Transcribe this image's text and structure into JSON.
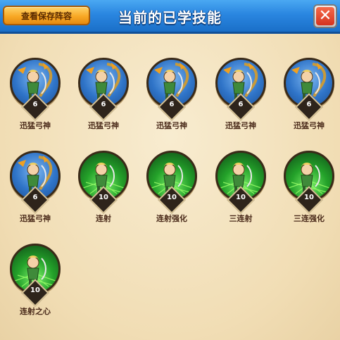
{
  "header": {
    "title": "当前的已学技能",
    "view_button_label": "查看保存阵容",
    "close_label": "✕"
  },
  "skills": [
    {
      "name": "迅猛弓神",
      "level": "6",
      "style": "blue"
    },
    {
      "name": "迅猛弓神",
      "level": "6",
      "style": "blue"
    },
    {
      "name": "迅猛弓神",
      "level": "6",
      "style": "blue"
    },
    {
      "name": "迅猛弓神",
      "level": "6",
      "style": "blue"
    },
    {
      "name": "迅猛弓神",
      "level": "6",
      "style": "blue"
    },
    {
      "name": "迅猛弓神",
      "level": "6",
      "style": "blue"
    },
    {
      "name": "连射",
      "level": "10",
      "style": "green"
    },
    {
      "name": "连射强化",
      "level": "10",
      "style": "green"
    },
    {
      "name": "三连射",
      "level": "10",
      "style": "green"
    },
    {
      "name": "三连强化",
      "level": "10",
      "style": "green"
    },
    {
      "name": "连射之心",
      "level": "10",
      "style": "green"
    }
  ],
  "colors": {
    "header_blue": "#2a86e0",
    "button_orange": "#f8a825",
    "close_red": "#d4331f",
    "panel_bg": "#f1ddb4",
    "name_text": "#4a2a1a"
  },
  "icons": {
    "close": "close-icon",
    "skill_portrait": "archer-hero-icon"
  }
}
